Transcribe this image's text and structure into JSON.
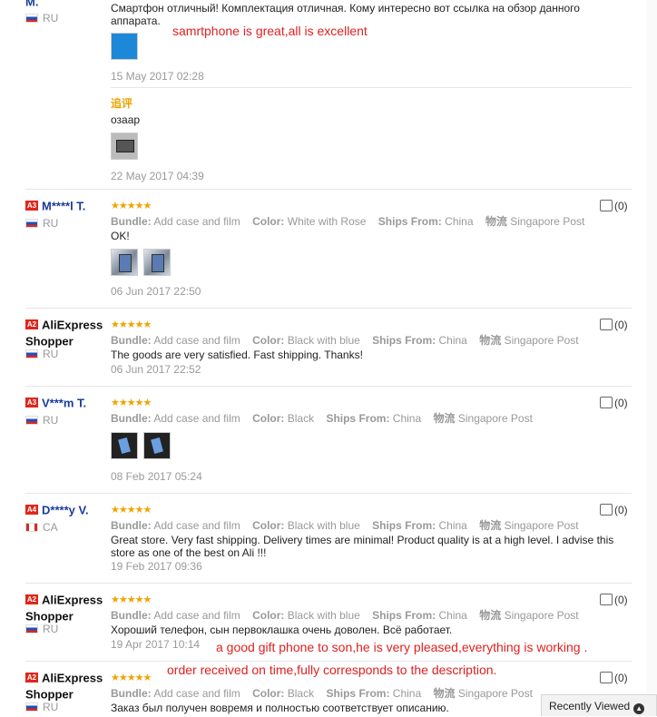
{
  "reviews": [
    {
      "username": "M.",
      "country": "RU",
      "text": "Смартфон отличный! Комплектация отличная. Кому интересно вот ссылка на обзор данного аппарата.",
      "date": "15 May 2017 02:28",
      "followup_label": "追评",
      "followup_text": "озаар",
      "followup_date": "22 May 2017 04:39"
    },
    {
      "level": "A3",
      "username": "M****l T.",
      "country": "RU",
      "stars": "★★★★★",
      "bundle_label": "Bundle:",
      "bundle": "Add case and film",
      "color_label": "Color:",
      "color": "White with Rose",
      "ships_label": "Ships From:",
      "ships": "China",
      "logistics_label": "物流",
      "logistics": "Singapore Post",
      "text": "OK!",
      "date": "06 Jun 2017 22:50",
      "likes": "(0)"
    },
    {
      "level": "A2",
      "username": "AliExpress Shopper",
      "country": "RU",
      "stars": "★★★★★",
      "bundle_label": "Bundle:",
      "bundle": "Add case and film",
      "color_label": "Color:",
      "color": "Black with blue",
      "ships_label": "Ships From:",
      "ships": "China",
      "logistics_label": "物流",
      "logistics": "Singapore Post",
      "text": "The goods are very satisfied. Fast shipping. Thanks!",
      "date": "06 Jun 2017 22:52",
      "likes": "(0)"
    },
    {
      "level": "A3",
      "username": "V***m T.",
      "country": "RU",
      "stars": "★★★★★",
      "bundle_label": "Bundle:",
      "bundle": "Add case and film",
      "color_label": "Color:",
      "color": "Black",
      "ships_label": "Ships From:",
      "ships": "China",
      "logistics_label": "物流",
      "logistics": "Singapore Post",
      "date": "08 Feb 2017 05:24",
      "likes": "(0)"
    },
    {
      "level": "A4",
      "username": "D****y V.",
      "country": "CA",
      "stars": "★★★★★",
      "bundle_label": "Bundle:",
      "bundle": "Add case and film",
      "color_label": "Color:",
      "color": "Black with blue",
      "ships_label": "Ships From:",
      "ships": "China",
      "logistics_label": "物流",
      "logistics": "Singapore Post",
      "text": "Great store. Very fast shipping. Delivery times are minimal! Product quality is at a high level. I advise this store as one of the best on Ali !!!",
      "date": "19 Feb 2017 09:36",
      "likes": "(0)"
    },
    {
      "level": "A2",
      "username": "AliExpress Shopper",
      "country": "RU",
      "stars": "★★★★★",
      "bundle_label": "Bundle:",
      "bundle": "Add case and film",
      "color_label": "Color:",
      "color": "Black with blue",
      "ships_label": "Ships From:",
      "ships": "China",
      "logistics_label": "物流",
      "logistics": "Singapore Post",
      "text": "Хороший телефон, сын первоклашка очень доволен. Всё работает.",
      "date": "19 Apr 2017 10:14",
      "likes": "(0)"
    },
    {
      "level": "A2",
      "username": "AliExpress Shopper",
      "country": "RU",
      "stars": "★★★★★",
      "bundle_label": "Bundle:",
      "bundle": "Add case and film",
      "color_label": "Color:",
      "color": "Black",
      "ships_label": "Ships From:",
      "ships": "China",
      "logistics_label": "物流",
      "logistics": "Singapore Post",
      "text": "Заказ был получен вовремя и полностью соответствует описанию.",
      "likes": "(0)"
    }
  ],
  "annotations": {
    "a1": "samrtphone is great,all is excellent",
    "a2": "a good gift phone to son,he is very pleased,everything is working .",
    "a3": "order received on time,fully corresponds to the description."
  },
  "recently_viewed": "Recently Viewed",
  "colors": {
    "star": "#f0a300",
    "username": "#1a3b9c",
    "annotation": "#e02020",
    "level_badge": "#e1251b"
  }
}
